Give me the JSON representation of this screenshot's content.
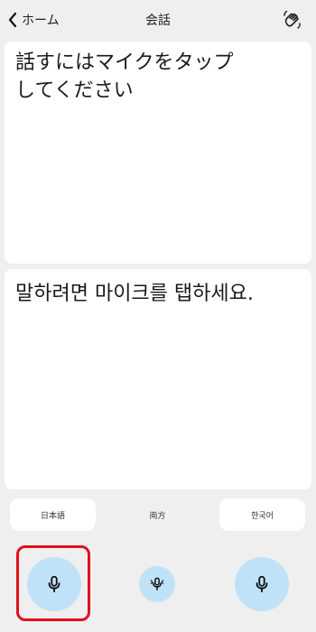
{
  "header": {
    "back_label": "ホーム",
    "title": "会話",
    "hand_icon": "waving-hand-icon"
  },
  "panels": {
    "japanese_prompt": "話すにはマイクをタップ\nしてください",
    "korean_prompt": "말하려면 마이크를 탭하세요."
  },
  "languages": {
    "left_label": "日本語",
    "both_label": "両方",
    "right_label": "한국어"
  },
  "mic_buttons": {
    "left_icon": "microphone-icon",
    "both_icon": "dual-microphone-icon",
    "right_icon": "microphone-icon"
  },
  "colors": {
    "background": "#efefef",
    "mic_fill": "#bfe2f8",
    "highlight_border": "#e0101d"
  }
}
